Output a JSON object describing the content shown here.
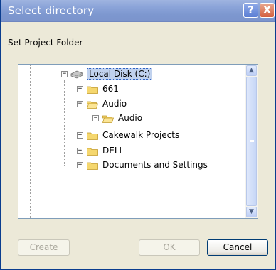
{
  "window": {
    "title": "Select directory",
    "help_label": "?",
    "close_label": "X"
  },
  "prompt": "Set Project Folder",
  "tree": {
    "nodes": [
      {
        "label": "Local Disk (C:)",
        "expander": "−",
        "icon": "drive-icon",
        "selected": true
      },
      {
        "label": "661",
        "expander": "+",
        "icon": "folder-icon"
      },
      {
        "label": "Audio",
        "expander": "−",
        "icon": "folder-open-icon"
      },
      {
        "label": "Audio",
        "expander": "−",
        "icon": "folder-open-icon"
      },
      {
        "label": "Cakewalk Projects",
        "expander": "+",
        "icon": "folder-icon"
      },
      {
        "label": "DELL",
        "expander": "+",
        "icon": "folder-icon"
      },
      {
        "label": "Documents and Settings",
        "expander": "+",
        "icon": "folder-icon"
      }
    ]
  },
  "scrollbar": {
    "up_label": "▲",
    "down_label": "▼"
  },
  "buttons": {
    "create": "Create",
    "ok": "OK",
    "cancel": "Cancel"
  },
  "colors": {
    "title_bar": "#8aa3d8",
    "dialog_bg": "#ece9d8",
    "selection_bg": "#c1d2ee",
    "folder": "#f5d76e"
  }
}
